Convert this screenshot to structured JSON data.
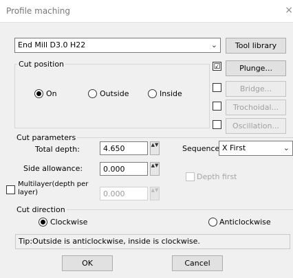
{
  "window": {
    "title": "Profile maching",
    "close_glyph": "×"
  },
  "tool": {
    "selected": "End Mill D3.0 H22",
    "library_button": "Tool library"
  },
  "cut_position": {
    "label": "Cut position",
    "options": [
      "On",
      "Outside",
      "Inside"
    ],
    "selected": "On"
  },
  "options": {
    "plunge": {
      "label": "Plunge...",
      "checked": true
    },
    "bridge": {
      "label": "Bridge...",
      "checked": false
    },
    "trochoidal": {
      "label": "Trochoidal...",
      "checked": false
    },
    "oscillation": {
      "label": "Oscillation...",
      "checked": false
    }
  },
  "cut_parameters": {
    "label": "Cut parameters",
    "total_depth_label": "Total depth:",
    "total_depth": "4.650",
    "side_allowance_label": "Side allowance:",
    "side_allowance": "0.000",
    "multilayer_label_1": "Multilayer(depth per",
    "multilayer_label_2": "layer)",
    "multilayer_value": "0.000",
    "sequence_label": "Sequence",
    "sequence_value": "X First",
    "depth_first_label": "Depth first"
  },
  "cut_direction": {
    "label": "Cut direction",
    "clockwise": "Clockwise",
    "anticlockwise": "Anticlockwise",
    "selected": "Clockwise"
  },
  "tip": "Tip:Outside is anticlockwise, inside is clockwise.",
  "footer": {
    "ok": "OK",
    "cancel": "Cancel"
  },
  "glyphs": {
    "dropdown": "⌵",
    "check": "☑",
    "spin": "▲▼"
  }
}
